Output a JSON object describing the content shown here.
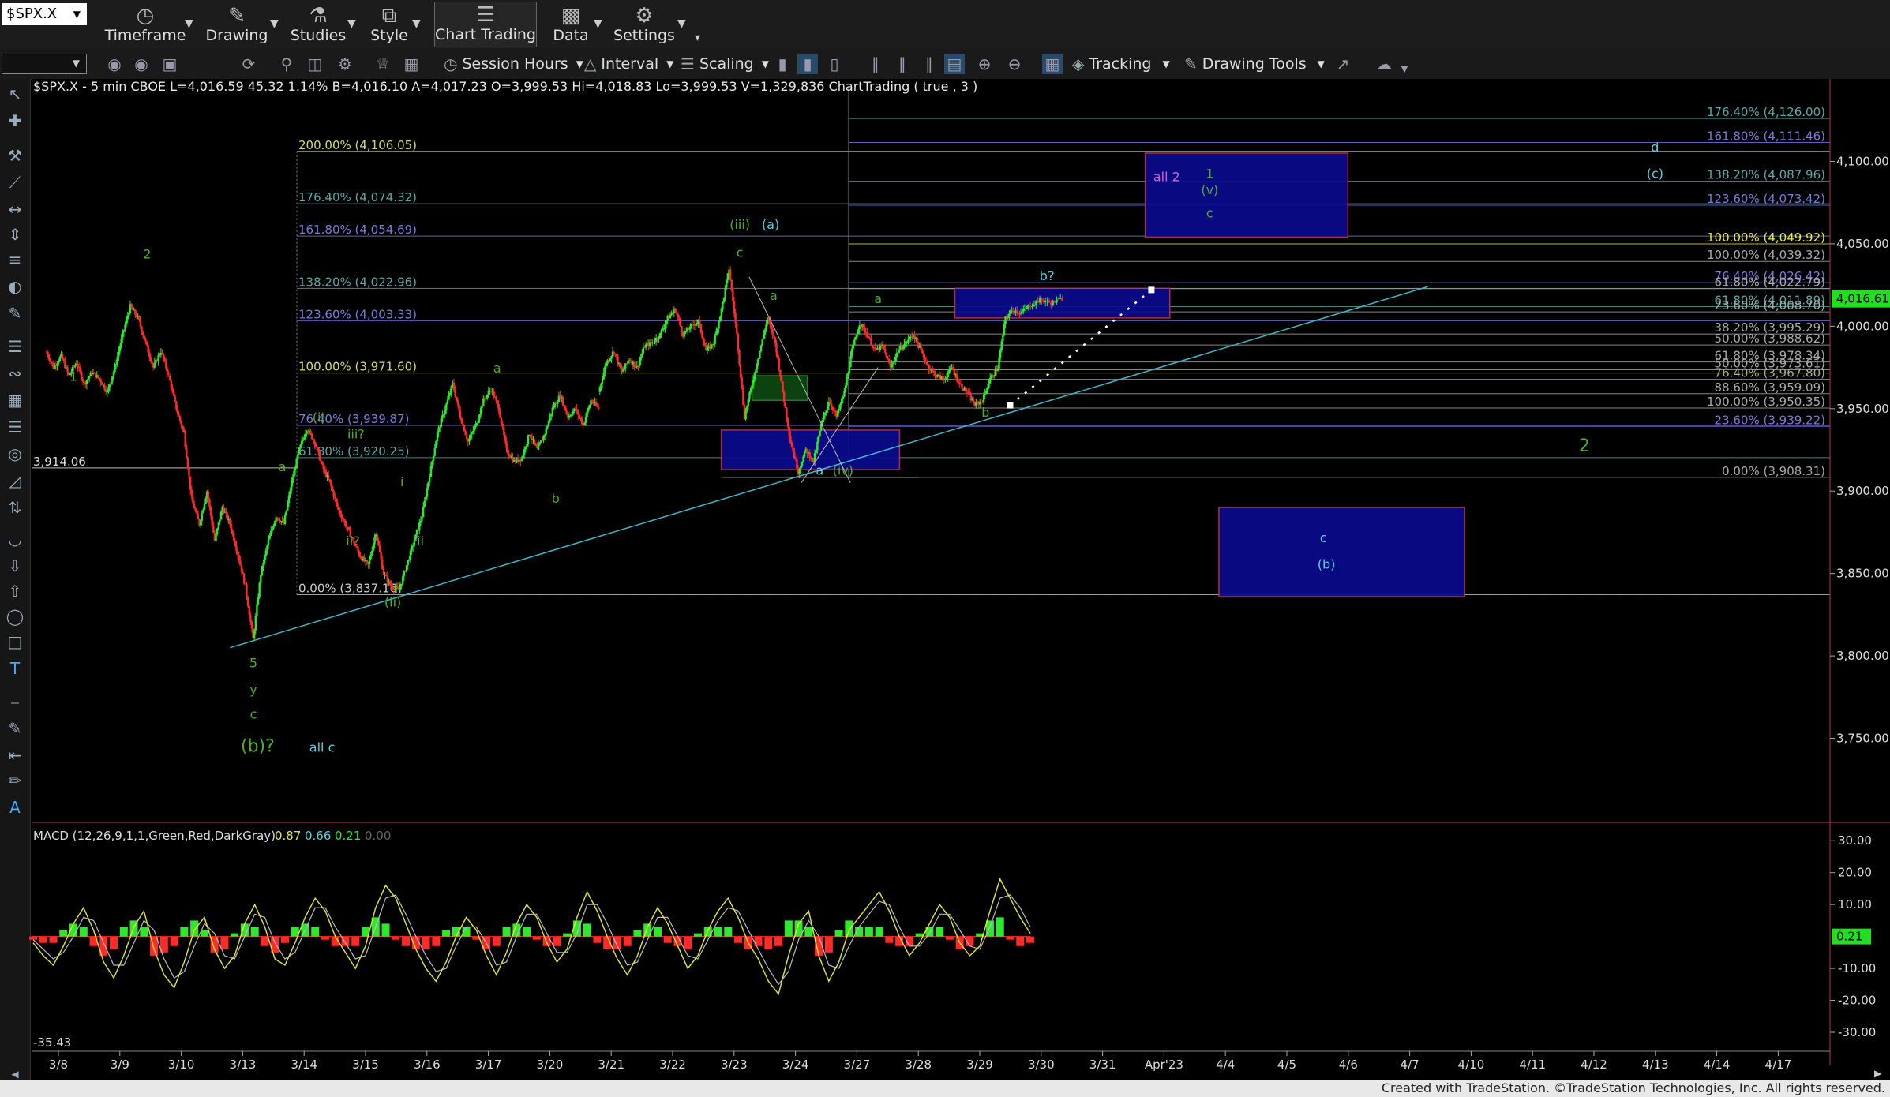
{
  "symbol": "$SPX.X",
  "toolbar": {
    "timeframe": "Timeframe",
    "drawing": "Drawing",
    "studies": "Studies",
    "style": "Style",
    "chart_trading": "Chart Trading",
    "data": "Data",
    "settings": "Settings",
    "session_hours": "Session Hours",
    "interval": "Interval",
    "scaling": "Scaling",
    "tracking": "Tracking",
    "drawing_tools": "Drawing Tools"
  },
  "chart_header": "$SPX.X - 5 min  CBOE  L=4,016.59  45.32  1.14%  B=4,016.10  A=4,017.23  O=3,999.53  Hi=4,018.83  Lo=3,999.53  V=1,329,836  ChartTrading ( true , 3 )",
  "footer": "Created with TradeStation. ©TradeStation Technologies, Inc. All rights reserved.",
  "colors": {
    "up": "#2ee82e",
    "down": "#ff2a2a",
    "price_marker": "#22dd22",
    "wave_green": "#4caf28",
    "wave_cyan": "#5ad0e0",
    "fib_blue": "#5b5bd6",
    "fib_yellow": "#d8d86a",
    "box_fill": "#0a0a8c",
    "box_border": "#c0304a",
    "trend": "#40b8c8",
    "macd_line": "#e8e830"
  },
  "chart_data": {
    "type": "line",
    "price": {
      "ylim": [
        3700,
        4150
      ],
      "yticks": [
        3750,
        3800,
        3850,
        3900,
        3950,
        4000,
        4050,
        4100
      ],
      "ytick_labels": [
        "3,750.00",
        "3,800.00",
        "3,850.00",
        "3,900.00",
        "3,950.00",
        "4,000.00",
        "4,050.00",
        "4,100.00"
      ],
      "last_label": "4,016.61",
      "last_value": 4016.61,
      "left_level_label": "3,914.06",
      "left_level_value": 3914.06,
      "dates": [
        "3/8",
        "3/9",
        "3/10",
        "3/13",
        "3/14",
        "3/15",
        "3/16",
        "3/17",
        "3/20",
        "3/21",
        "3/22",
        "3/23",
        "3/24",
        "3/27",
        "3/28",
        "3/29",
        "3/30",
        "3/31",
        "Apr'23",
        "4/4",
        "4/5",
        "4/6",
        "4/7",
        "4/10",
        "4/11",
        "4/12",
        "4/13",
        "4/14",
        "4/17"
      ],
      "series": [
        {
          "values": [
            3985,
            3975,
            3982,
            3970,
            3978,
            3965,
            3972,
            3968,
            3960
          ]
        },
        {
          "values": [
            3960,
            3975,
            3995,
            4012,
            4005,
            3990,
            3975,
            3985,
            3970
          ]
        },
        {
          "values": [
            3970,
            3950,
            3935,
            3895,
            3880,
            3900,
            3870,
            3890,
            3880
          ]
        },
        {
          "values": [
            3880,
            3862,
            3842,
            3810,
            3850,
            3870,
            3885,
            3880,
            3905
          ]
        },
        {
          "values": [
            3905,
            3925,
            3938,
            3930,
            3915,
            3905,
            3890,
            3880,
            3870
          ]
        },
        {
          "values": [
            3870,
            3860,
            3855,
            3875,
            3850,
            3842,
            3840,
            3855,
            3870
          ]
        },
        {
          "values": [
            3870,
            3885,
            3910,
            3935,
            3950,
            3965,
            3945,
            3930,
            3940
          ]
        },
        {
          "values": [
            3940,
            3955,
            3962,
            3950,
            3925,
            3918,
            3920,
            3935,
            3925
          ]
        },
        {
          "values": [
            3925,
            3935,
            3950,
            3958,
            3945,
            3950,
            3940,
            3955,
            3950
          ]
        },
        {
          "values": [
            3960,
            3978,
            3985,
            3972,
            3980,
            3975,
            3988,
            3990,
            3995
          ]
        },
        {
          "values": [
            3995,
            4005,
            4010,
            3995,
            4000,
            4003,
            3985,
            3990,
            4010
          ]
        },
        {
          "values": [
            4010,
            4035,
            3995,
            3945,
            3965,
            3985,
            4005,
            3990,
            3960
          ]
        },
        {
          "values": [
            3960,
            3930,
            3912,
            3925,
            3918,
            3940,
            3955,
            3945,
            3960
          ]
        },
        {
          "values": [
            3960,
            3985,
            4002,
            3995,
            3985,
            3988,
            3975,
            3985,
            3990
          ]
        },
        {
          "values": [
            3990,
            3995,
            3985,
            3975,
            3970,
            3968,
            3975,
            3965,
            3960
          ]
        },
        {
          "values": [
            3960,
            3952,
            3955,
            3968,
            3975,
            4005,
            4010,
            4008,
            4012
          ]
        },
        {
          "values": [
            4012,
            4016,
            4014,
            4016.61
          ]
        }
      ],
      "fib_left": [
        {
          "label": "200.00% (4,106.05)",
          "value": 4106.05,
          "color": "#d8d86a"
        },
        {
          "label": "176.40% (4,074.32)",
          "value": 4074.32,
          "color": "#5aa8a8"
        },
        {
          "label": "161.80% (4,054.69)",
          "value": 4054.69,
          "color": "#7a7ae0"
        },
        {
          "label": "138.20% (4,022.96)",
          "value": 4022.96,
          "color": "#5aa8a8"
        },
        {
          "label": "123.60% (4,003.33)",
          "value": 4003.33,
          "color": "#7a7ae0"
        },
        {
          "label": "100.00% (3,971.60)",
          "value": 3971.6,
          "color": "#d8d86a"
        },
        {
          "label": "76.40% (3,939.87)",
          "value": 3939.87,
          "color": "#7a7ae0"
        },
        {
          "label": "61.80% (3,920.25)",
          "value": 3920.25,
          "color": "#5aa8a8"
        },
        {
          "label": "0.00% (3,837.16)",
          "value": 3837.16,
          "color": "#cccccc"
        }
      ],
      "fib_right": [
        {
          "label": "176.40% (4,126.00)",
          "value": 4126.0,
          "color": "#5aa8a8"
        },
        {
          "label": "161.80% (4,111.46)",
          "value": 4111.46,
          "color": "#7a7ae0"
        },
        {
          "label": "138.20% (4,087.96)",
          "value": 4087.96,
          "color": "#5aa8a8"
        },
        {
          "label": "123.60% (4,073.42)",
          "value": 4073.42,
          "color": "#7a7ae0"
        },
        {
          "label": "100.00% (4,049.92)",
          "value": 4049.92,
          "color": "#e8e840"
        },
        {
          "label": "100.00% (4,039.32)",
          "value": 4039.32,
          "color": "#aaaaaa"
        },
        {
          "label": "76.40% (4,026.42)",
          "value": 4026.42,
          "color": "#7a7ae0"
        },
        {
          "label": "61.80% (4,022.79)",
          "value": 4022.79,
          "color": "#aaaaaa"
        },
        {
          "label": "61.80% (4,011.89)",
          "value": 4011.89,
          "color": "#5aa8a8"
        },
        {
          "label": "23.60% (4,008.70)",
          "value": 4008.7,
          "color": "#aaaaaa"
        },
        {
          "label": "38.20% (3,995.29)",
          "value": 3995.29,
          "color": "#aaaaaa"
        },
        {
          "label": "50.00% (3,988.62)",
          "value": 3988.62,
          "color": "#aaaaaa"
        },
        {
          "label": "61.80% (3,978.34)",
          "value": 3978.34,
          "color": "#aaaaaa"
        },
        {
          "label": "50.00% (3,973.61)",
          "value": 3973.61,
          "color": "#aaaaaa"
        },
        {
          "label": "76.40% (3,967.80)",
          "value": 3967.8,
          "color": "#aaaaaa"
        },
        {
          "label": "88.60% (3,959.09)",
          "value": 3959.09,
          "color": "#aaaaaa"
        },
        {
          "label": "100.00% (3,950.35)",
          "value": 3950.35,
          "color": "#aaaaaa"
        },
        {
          "label": "23.60% (3,939.22)",
          "value": 3939.22,
          "color": "#7a7ae0"
        },
        {
          "label": "0.00% (3,908.31)",
          "value": 3908.31,
          "color": "#aaaaaa"
        }
      ],
      "boxes": [
        {
          "x": [
            11.0,
            13.9
          ],
          "y": [
            3913,
            3937
          ],
          "type": "blue"
        },
        {
          "x": [
            11.5,
            12.4
          ],
          "y": [
            3955,
            3970
          ],
          "type": "green"
        },
        {
          "x": [
            14.8,
            18.3
          ],
          "y": [
            4005,
            4023
          ],
          "type": "blue"
        },
        {
          "x": [
            17.9,
            21.2
          ],
          "y": [
            4054,
            4105
          ],
          "type": "blue"
        },
        {
          "x": [
            19.1,
            23.1
          ],
          "y": [
            3836,
            3890
          ],
          "type": "blue"
        }
      ],
      "trendline": {
        "x": [
          3.0,
          22.5
        ],
        "y": [
          3805,
          4024
        ]
      },
      "projection": {
        "x": [
          15.7,
          18.0
        ],
        "y": [
          3952,
          4022
        ]
      },
      "wave_labels": [
        {
          "t": "2",
          "x": 1.65,
          "y": 4041,
          "c": "green"
        },
        {
          "t": "1",
          "x": 0.45,
          "y": 3967,
          "c": "green"
        },
        {
          "t": "a",
          "x": 3.85,
          "y": 3912,
          "c": "green"
        },
        {
          "t": "5",
          "x": 3.38,
          "y": 3793,
          "c": "green"
        },
        {
          "t": "y",
          "x": 3.38,
          "y": 3777,
          "c": "green"
        },
        {
          "t": "c",
          "x": 3.38,
          "y": 3762,
          "c": "green"
        },
        {
          "t": "(b)?",
          "x": 3.45,
          "y": 3742,
          "c": "green",
          "big": true
        },
        {
          "t": "all c",
          "x": 4.5,
          "y": 3742,
          "c": "cyan"
        },
        {
          "t": "(i)",
          "x": 4.45,
          "y": 3942,
          "c": "green"
        },
        {
          "t": "iii?",
          "x": 5.05,
          "y": 3932,
          "c": "green"
        },
        {
          "t": "ii?",
          "x": 5.0,
          "y": 3867,
          "c": "green"
        },
        {
          "t": "i",
          "x": 5.8,
          "y": 3903,
          "c": "green"
        },
        {
          "t": "ii",
          "x": 6.1,
          "y": 3867,
          "c": "green"
        },
        {
          "t": "(ii)",
          "x": 5.65,
          "y": 3830,
          "c": "green"
        },
        {
          "t": "a",
          "x": 7.35,
          "y": 3972,
          "c": "green"
        },
        {
          "t": "b",
          "x": 8.3,
          "y": 3893,
          "c": "green"
        },
        {
          "t": "(iii)",
          "x": 11.3,
          "y": 4059,
          "c": "green"
        },
        {
          "t": "(a)",
          "x": 11.8,
          "y": 4059,
          "c": "cyan"
        },
        {
          "t": "c",
          "x": 11.3,
          "y": 4042,
          "c": "green"
        },
        {
          "t": "a",
          "x": 11.85,
          "y": 4016,
          "c": "green"
        },
        {
          "t": "a",
          "x": 12.6,
          "y": 3910,
          "c": "cyan"
        },
        {
          "t": "(iv)",
          "x": 12.98,
          "y": 3910,
          "c": "green"
        },
        {
          "t": "a",
          "x": 13.55,
          "y": 4014,
          "c": "green"
        },
        {
          "t": "b",
          "x": 15.3,
          "y": 3945,
          "c": "green"
        },
        {
          "t": "b?",
          "x": 16.3,
          "y": 4028,
          "c": "cyan"
        },
        {
          "t": "all 2",
          "x": 18.25,
          "y": 4088,
          "c": "magenta"
        },
        {
          "t": "1",
          "x": 18.95,
          "y": 4090,
          "c": "green"
        },
        {
          "t": "(v)",
          "x": 18.95,
          "y": 4080,
          "c": "green"
        },
        {
          "t": "c",
          "x": 18.95,
          "y": 4066,
          "c": "green"
        },
        {
          "t": "d",
          "x": 26.2,
          "y": 4106,
          "c": "cyan"
        },
        {
          "t": "(c)",
          "x": 26.2,
          "y": 4090,
          "c": "cyan"
        },
        {
          "t": "2",
          "x": 25.05,
          "y": 3924,
          "c": "green",
          "big": true
        },
        {
          "t": "c",
          "x": 20.8,
          "y": 3869,
          "c": "cyan"
        },
        {
          "t": "(b)",
          "x": 20.85,
          "y": 3853,
          "c": "cyan"
        }
      ]
    },
    "macd": {
      "title": "MACD (12,26,9,1,1,Green,Red,DarkGray)",
      "values_text": [
        "0.87",
        "0.66",
        "0.21",
        "0.00"
      ],
      "ylim": [
        -35.43,
        35
      ],
      "yticks": [
        30,
        20,
        10,
        -10,
        -20,
        -30
      ],
      "ytick_labels": [
        "30.00",
        "20.00",
        "10.00",
        "-10.00",
        "-20.00",
        "-30.00"
      ],
      "min_label": "-35.43",
      "last_label": "0.21",
      "macd_line": [
        -2,
        -6,
        -9,
        -3,
        4,
        9,
        2,
        -8,
        -13,
        -6,
        3,
        8,
        -4,
        -12,
        -16,
        -8,
        2,
        6,
        -4,
        -10,
        -6,
        4,
        10,
        3,
        -7,
        -9,
        -2,
        6,
        12,
        8,
        0,
        -5,
        -10,
        -3,
        9,
        16,
        12,
        4,
        -4,
        -10,
        -14,
        -8,
        0,
        6,
        2,
        -6,
        -12,
        -5,
        4,
        10,
        6,
        -2,
        -8,
        -4,
        6,
        14,
        8,
        0,
        -7,
        -12,
        -6,
        3,
        9,
        4,
        -3,
        -10,
        -6,
        2,
        8,
        12,
        6,
        -2,
        -7,
        -14,
        -18,
        -6,
        4,
        8,
        -6,
        -14,
        -8,
        2,
        6,
        10,
        14,
        8,
        0,
        -6,
        -2,
        4,
        10,
        6,
        -2,
        -6,
        -3,
        8,
        18,
        12,
        6,
        1
      ],
      "signal_line": [
        -1,
        -4,
        -7,
        -5,
        0,
        6,
        5,
        -2,
        -9,
        -9,
        -2,
        5,
        2,
        -7,
        -13,
        -11,
        -3,
        4,
        1,
        -6,
        -7,
        0,
        7,
        6,
        -2,
        -7,
        -5,
        2,
        9,
        9,
        3,
        -2,
        -7,
        -6,
        3,
        12,
        13,
        7,
        0,
        -6,
        -11,
        -10,
        -3,
        3,
        3,
        -2,
        -9,
        -8,
        0,
        7,
        7,
        1,
        -5,
        -5,
        1,
        10,
        10,
        4,
        -3,
        -9,
        -8,
        -1,
        6,
        6,
        0,
        -6,
        -7,
        -1,
        5,
        9,
        8,
        2,
        -4,
        -10,
        -15,
        -11,
        -1,
        5,
        0,
        -9,
        -10,
        -3,
        3,
        7,
        11,
        10,
        3,
        -3,
        -3,
        1,
        7,
        7,
        2,
        -3,
        -4,
        3,
        12,
        13,
        9,
        3
      ]
    }
  }
}
